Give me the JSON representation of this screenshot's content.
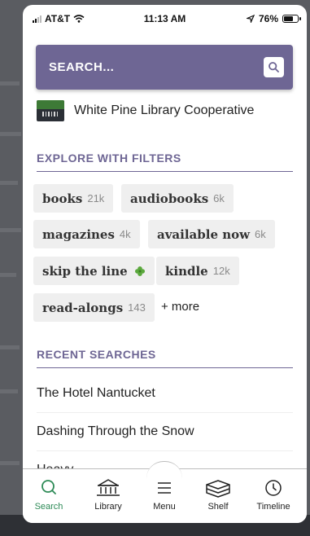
{
  "status_bar": {
    "carrier": "AT&T",
    "time": "11:13 AM",
    "battery": "76%",
    "battery_level": 0.76
  },
  "search": {
    "placeholder": "SEARCH..."
  },
  "library": {
    "name": "White Pine Library Cooperative"
  },
  "filters": {
    "heading": "EXPLORE WITH FILTERS",
    "chips": [
      {
        "label": "books",
        "count": "21k"
      },
      {
        "label": "audiobooks",
        "count": "6k"
      },
      {
        "label": "magazines",
        "count": "4k"
      },
      {
        "label": "available now",
        "count": "6k"
      },
      {
        "label": "skip the line",
        "icon": "clover-icon"
      },
      {
        "label": "kindle",
        "count": "12k"
      },
      {
        "label": "read-alongs",
        "count": "143"
      }
    ],
    "more_label": "+ more"
  },
  "recent": {
    "heading": "RECENT SEARCHES",
    "items": [
      "The Hotel Nantucket",
      "Dashing Through the Snow",
      "Heavy"
    ]
  },
  "tabs": [
    {
      "label": "Search",
      "icon": "search-icon",
      "active": true
    },
    {
      "label": "Library",
      "icon": "library-icon",
      "active": false
    },
    {
      "label": "Menu",
      "icon": "menu-icon",
      "active": false
    },
    {
      "label": "Shelf",
      "icon": "shelf-icon",
      "active": false
    },
    {
      "label": "Timeline",
      "icon": "clock-icon",
      "active": false
    }
  ],
  "colors": {
    "accent": "#6e6694",
    "active_tab": "#2e8b57",
    "chip_bg": "#efefef"
  }
}
